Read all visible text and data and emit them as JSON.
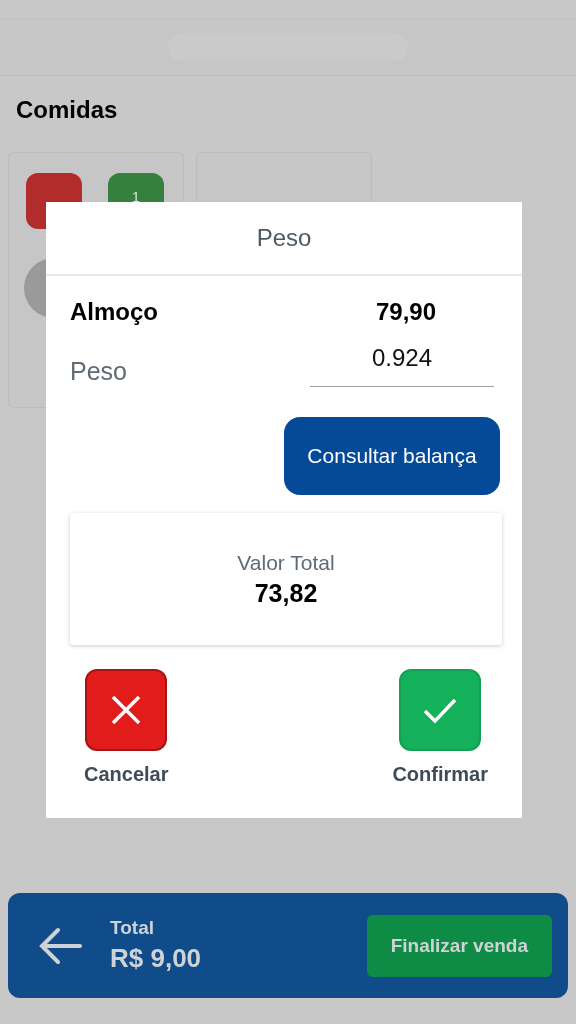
{
  "section_title": "Comidas",
  "product_card": {
    "badge": "1"
  },
  "dialog": {
    "title": "Peso",
    "item_name": "Almoço",
    "item_price": "79,90",
    "weight_label": "Peso",
    "weight_value": "0.924",
    "scale_button": "Consultar balança",
    "total_label": "Valor Total",
    "total_value": "73,82",
    "actions": [
      {
        "kind": "cancel",
        "label": "Cancelar"
      },
      {
        "kind": "confirm",
        "label": "Confirmar"
      }
    ]
  },
  "bottom_bar": {
    "total_label": "Total",
    "total_value": "R$ 9,00",
    "finish_button": "Finalizar venda"
  }
}
